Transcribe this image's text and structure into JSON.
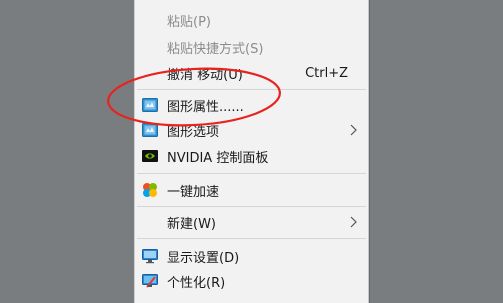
{
  "menu": {
    "paste": "粘贴(P)",
    "paste_shortcut": "粘贴快捷方式(S)",
    "undo_move": "撤消 移动(U)",
    "undo_move_key": "Ctrl+Z",
    "graphics_properties": "图形属性......",
    "graphics_options": "图形选项",
    "nvidia_panel": "NVIDIA 控制面板",
    "one_key_speedup": "一键加速",
    "new": "新建(W)",
    "display_settings": "显示设置(D)",
    "personalize": "个性化(R)"
  },
  "annotation": {
    "color": "#e8231f"
  },
  "icons": {
    "graphics_properties": "intel-graphics-icon",
    "graphics_options": "intel-graphics-icon",
    "nvidia_panel": "nvidia-icon",
    "one_key_speedup": "speedup-icon",
    "display_settings": "monitor-icon",
    "personalize": "personalize-icon"
  }
}
